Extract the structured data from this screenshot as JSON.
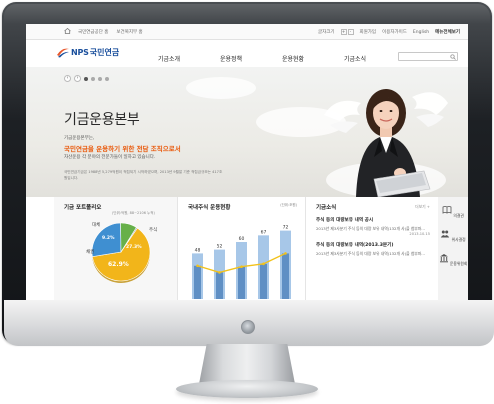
{
  "utility": {
    "links_left": [
      "국민연금공단 홈",
      "보건복지부 홈"
    ],
    "font_size_label": "글자크기",
    "font_size_buttons": [
      "+",
      "-"
    ],
    "links_right": [
      "회원가입",
      "이용자가이드",
      "English"
    ],
    "sitemap": "메뉴전체보기"
  },
  "header": {
    "logo_text": "NPS",
    "logo_korean": "국민연금",
    "nav": [
      "기금소개",
      "운용정책",
      "운용현황",
      "기금소식"
    ],
    "search_placeholder": ""
  },
  "hero": {
    "slide_count": 4,
    "active_slide": 1,
    "title": "기금운용본부",
    "sub": "기금운용본부는,",
    "accent": "국민연금을 운용하기 위한 전담 조직으로서",
    "line2": "자산운용 각 분야의 전문가들이 일하고 있습니다.",
    "note": "국민연금기금은 1988년 5,279억원이 적립되기 시작하였으며, 2013년 9월말 기준 적립금규모는 417조원입니다."
  },
  "portfolio": {
    "title": "기금 포트폴리오",
    "unit": "(단위:억원, 88~2106 누적)",
    "chart_data": {
      "type": "pie",
      "slices": [
        {
          "label": "채권",
          "value": 62.9,
          "color": "#f2b51a",
          "value_text": "62.9%"
        },
        {
          "label": "주식",
          "value": 27.3,
          "color": "#3f8fd1",
          "value_text": "27.3%"
        },
        {
          "label": "대체",
          "value": 9.2,
          "color": "#67b04a",
          "value_text": "9.2%"
        },
        {
          "label": "기타",
          "value": 0.6,
          "color": "#8a8a8a",
          "value_text": ""
        }
      ]
    }
  },
  "stock": {
    "title": "국내주식 운용현황",
    "unit": "(단위:조원)",
    "chart_data": {
      "type": "bar",
      "values": [
        48,
        52,
        60,
        67,
        72
      ],
      "line_values": [
        35,
        28,
        34,
        37,
        48
      ],
      "title": "국내주식 운용현황"
    }
  },
  "news": {
    "title": "기금소식",
    "more": "더보기 +",
    "items": [
      {
        "title": "주식 등의 대량보유 내역 공시",
        "desc": "2013년 제3사분기 주식 등의 대량 보유 내역(132개 사)을 첨부파...",
        "date": "2013.10.15"
      },
      {
        "title": "주식 등의 대량보유 내역(2013.3분기)",
        "desc": "2013년 제3사분기 주식 등의 대량 보유 내역(132개 사)을 첨부파...",
        "date": ""
      }
    ]
  },
  "quick": {
    "items": [
      {
        "label": "의결권",
        "icon": "book-icon"
      },
      {
        "label": "위사결정",
        "icon": "people-icon"
      },
      {
        "label": "운용위원회",
        "icon": "building-icon"
      }
    ]
  }
}
